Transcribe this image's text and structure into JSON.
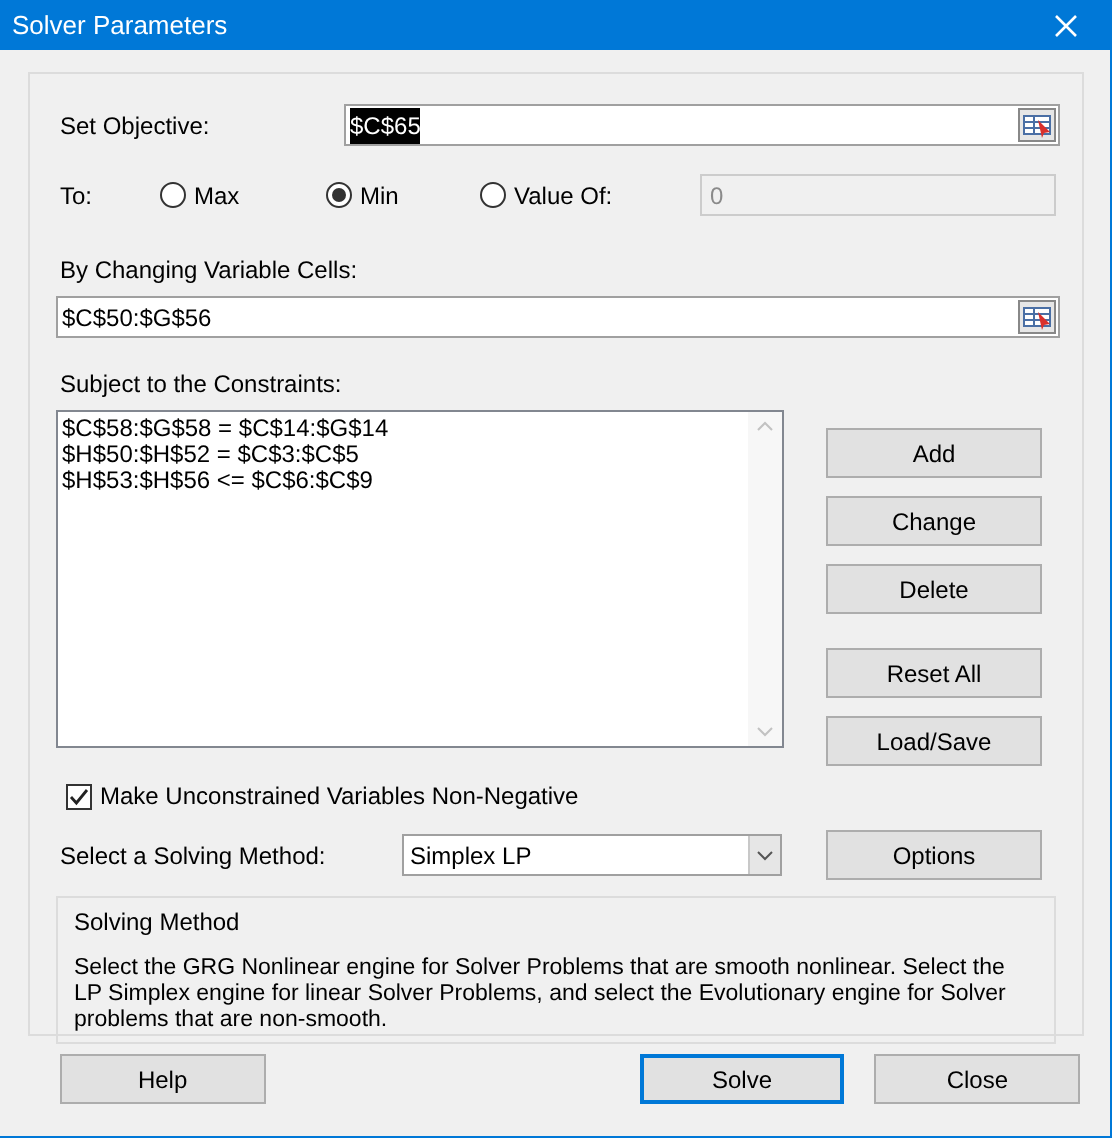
{
  "window": {
    "title": "Solver Parameters"
  },
  "objective": {
    "label": "Set Objective:",
    "value": "$C$65",
    "value_selected": true
  },
  "to": {
    "label": "To:",
    "options": [
      {
        "label": "Max",
        "selected": false
      },
      {
        "label": "Min",
        "selected": true
      },
      {
        "label": "Value Of:",
        "selected": false
      }
    ],
    "value_of": {
      "value": "0",
      "disabled": true
    }
  },
  "changing": {
    "label": "By Changing Variable Cells:",
    "value": "$C$50:$G$56"
  },
  "constraints": {
    "label": "Subject to the Constraints:",
    "items": [
      "$C$58:$G$58 = $C$14:$G$14",
      "$H$50:$H$52 = $C$3:$C$5",
      "$H$53:$H$56 <= $C$6:$C$9"
    ]
  },
  "side_buttons": [
    {
      "label": "Add"
    },
    {
      "label": "Change"
    },
    {
      "label": "Delete"
    },
    {
      "label": "Reset All"
    },
    {
      "label": "Load/Save"
    }
  ],
  "non_negative": {
    "label": "Make Unconstrained Variables Non-Negative",
    "checked": true
  },
  "method": {
    "label": "Select a Solving Method:",
    "value": "Simplex LP",
    "options_button": "Options"
  },
  "description": {
    "title": "Solving Method",
    "text": "Select the GRG Nonlinear engine for Solver Problems that are smooth nonlinear. Select the LP Simplex engine for linear Solver Problems, and select the Evolutionary engine for Solver problems that are non-smooth."
  },
  "footer_buttons": [
    {
      "label": "Help",
      "default": false
    },
    {
      "label": "Solve",
      "default": true
    },
    {
      "label": "Close",
      "default": false
    }
  ]
}
